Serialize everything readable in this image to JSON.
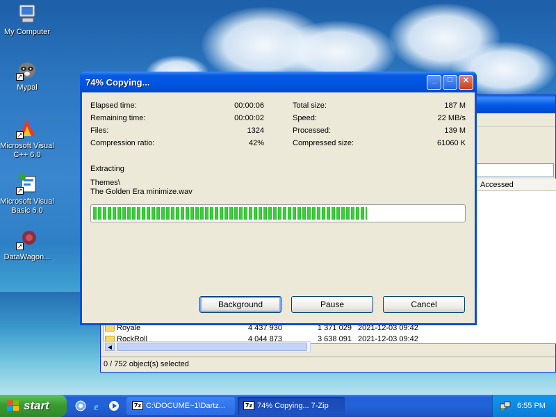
{
  "desktop": {
    "icons": [
      {
        "label": "My Computer",
        "icon": "my-computer-icon"
      },
      {
        "label": "Mypal",
        "icon": "mypal-raccoon-icon"
      },
      {
        "label": "Microsoft Visual C++ 6.0",
        "icon": "visual-cpp-icon"
      },
      {
        "label": "Microsoft Visual Basic 6.0",
        "icon": "visual-basic-icon"
      },
      {
        "label": "DataWagon...",
        "icon": "datawagon-icon"
      }
    ]
  },
  "background_window": {
    "columns": [
      "Accessed"
    ],
    "rows": [
      {
        "name": "Royale",
        "size": "4 437 930",
        "packed": "1 371 029",
        "modified": "2021-12-03 09:42"
      },
      {
        "name": "RockRoll",
        "size": "4 044 873",
        "packed": "3 638 091",
        "modified": "2021-12-03 09:42"
      }
    ],
    "status": "0 / 752 object(s) selected"
  },
  "dialog": {
    "title": "74% Copying...",
    "left_stats": [
      {
        "label": "Elapsed time:",
        "value": "00:00:06"
      },
      {
        "label": "Remaining time:",
        "value": "00:00:02"
      },
      {
        "label": "Files:",
        "value": "1324"
      },
      {
        "label": "Compression ratio:",
        "value": "42%"
      }
    ],
    "right_stats": [
      {
        "label": "Total size:",
        "value": "187 M"
      },
      {
        "label": "Speed:",
        "value": "22 MB/s"
      },
      {
        "label": "Processed:",
        "value": "139 M"
      },
      {
        "label": "Compressed size:",
        "value": "61060 K"
      }
    ],
    "operation": "Extracting",
    "current_path": "Themes\\",
    "current_file": "The Golden Era minimize.wav",
    "progress_percent": 74,
    "buttons": {
      "background": "Background",
      "pause": "Pause",
      "cancel": "Cancel"
    },
    "caption_buttons": {
      "minimize": "_",
      "maximize": "□",
      "close": "✕"
    }
  },
  "taskbar": {
    "start_label": "start",
    "tasks": [
      {
        "label": "C:\\DOCUME~1\\Dartz...",
        "icon_text": "7z"
      },
      {
        "label": "74% Copying... 7-Zip",
        "icon_text": "7z"
      }
    ],
    "clock": "6:55 PM"
  }
}
